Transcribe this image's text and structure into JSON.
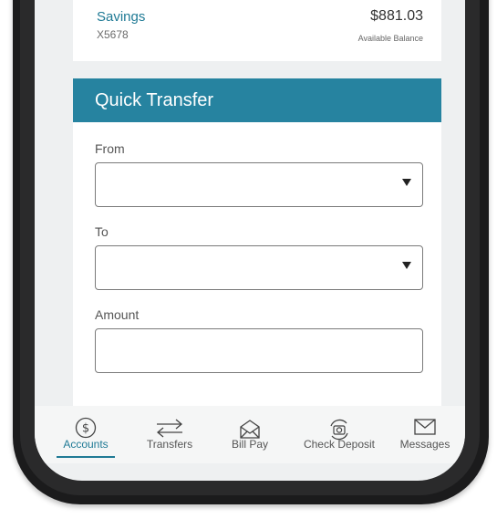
{
  "account": {
    "name": "Savings",
    "number": "X5678",
    "balance": "$881.03",
    "balance_label": "Available Balance"
  },
  "quick_transfer": {
    "title": "Quick Transfer",
    "from_label": "From",
    "from_value": "",
    "to_label": "To",
    "to_value": "",
    "amount_label": "Amount",
    "amount_value": ""
  },
  "nav": {
    "items": [
      {
        "label": "Accounts",
        "icon": "dollar-circle-icon",
        "active": true
      },
      {
        "label": "Transfers",
        "icon": "transfer-arrows-icon",
        "active": false
      },
      {
        "label": "Bill Pay",
        "icon": "envelope-open-icon",
        "active": false
      },
      {
        "label": "Check Deposit",
        "icon": "camera-refresh-icon",
        "active": false
      },
      {
        "label": "Messages",
        "icon": "mail-icon",
        "active": false
      }
    ]
  },
  "colors": {
    "accent": "#2683a0",
    "link": "#1f7a95",
    "frame": "#1b1b1c"
  }
}
